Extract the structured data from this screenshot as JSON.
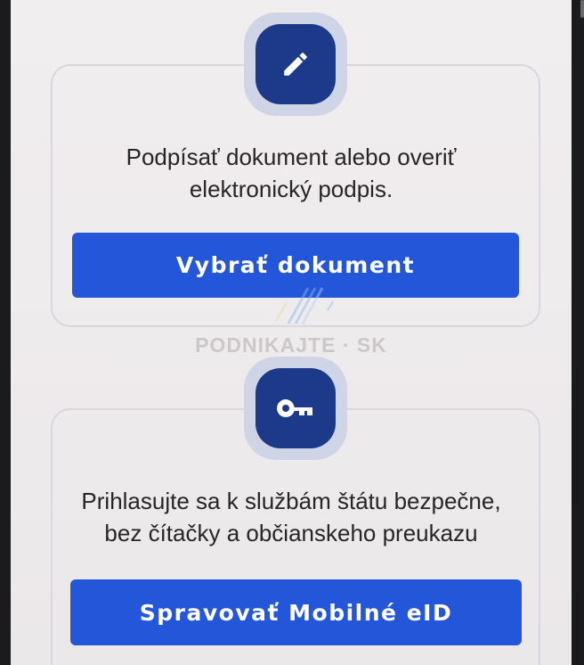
{
  "sign_card": {
    "description_line1": "Podpísať dokument alebo overiť",
    "description_line2": "elektronický podpis.",
    "button_label": "Vybrať dokument",
    "icon": "pencil-icon"
  },
  "eid_card": {
    "description_line1": "Prihlasujte sa k službám štátu bezpečne,",
    "description_line2": "bez čítačky a občianskeho preukazu",
    "button_label": "Spravovať Mobilné eID",
    "icon": "key-icon"
  },
  "watermark": {
    "text": "PODNIKAJTE · SK"
  },
  "colors": {
    "primary_button": "#2456d9",
    "icon_background": "#1d3a8a",
    "icon_ring": "#cfd4e6",
    "card_border": "#d9d6df",
    "screen_background": "#eeebec"
  }
}
